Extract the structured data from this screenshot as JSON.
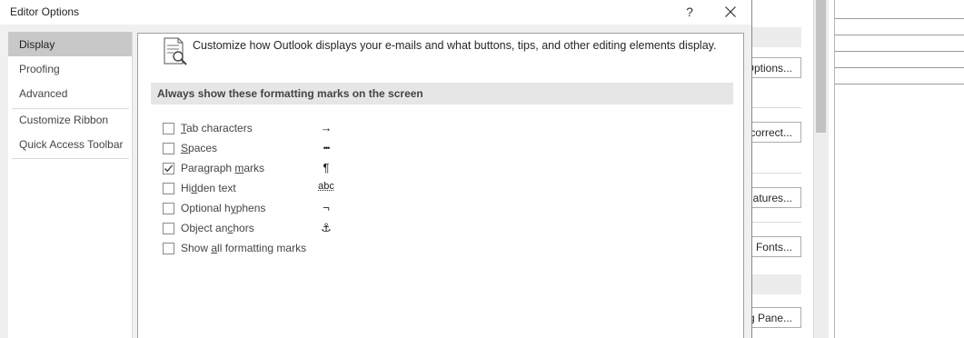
{
  "dialog": {
    "title": "Editor Options",
    "help_label": "?"
  },
  "sidebar": {
    "items": [
      {
        "label": "Display"
      },
      {
        "label": "Proofing"
      },
      {
        "label": "Advanced"
      },
      {
        "label": "Customize Ribbon"
      },
      {
        "label": "Quick Access Toolbar"
      }
    ],
    "selected": "Display"
  },
  "content": {
    "intro": "Customize how Outlook displays your e-mails and what buttons, tips, and other editing elements display.",
    "section_header": "Always show these formatting marks on the screen",
    "options": [
      {
        "pre": "",
        "key": "T",
        "post": "ab characters",
        "checked": false,
        "symbol": "→",
        "symbol_icon": "arrow-right-icon"
      },
      {
        "pre": "",
        "key": "S",
        "post": "paces",
        "checked": false,
        "symbol": "•••",
        "symbol_icon": "dots-icon"
      },
      {
        "pre": "Paragraph ",
        "key": "m",
        "post": "arks",
        "checked": true,
        "symbol": "¶",
        "symbol_icon": "pilcrow-icon"
      },
      {
        "pre": "Hi",
        "key": "d",
        "post": "den text",
        "checked": false,
        "symbol": "abc",
        "symbol_icon": "hidden-text-icon"
      },
      {
        "pre": "Optional h",
        "key": "y",
        "post": "phens",
        "checked": false,
        "symbol": "¬",
        "symbol_icon": "not-sign-icon"
      },
      {
        "pre": "Object an",
        "key": "c",
        "post": "hors",
        "checked": false,
        "symbol": "⚓",
        "symbol_icon": "anchor-icon"
      },
      {
        "pre": "Show ",
        "key": "a",
        "post": "ll formatting marks",
        "checked": false,
        "symbol": "",
        "symbol_icon": ""
      }
    ]
  },
  "background": {
    "buttons": [
      {
        "label": "Options..."
      },
      {
        "label": "correct..."
      },
      {
        "label": "natures..."
      },
      {
        "label": "d Fonts..."
      },
      {
        "label": "g Pane..."
      }
    ]
  }
}
